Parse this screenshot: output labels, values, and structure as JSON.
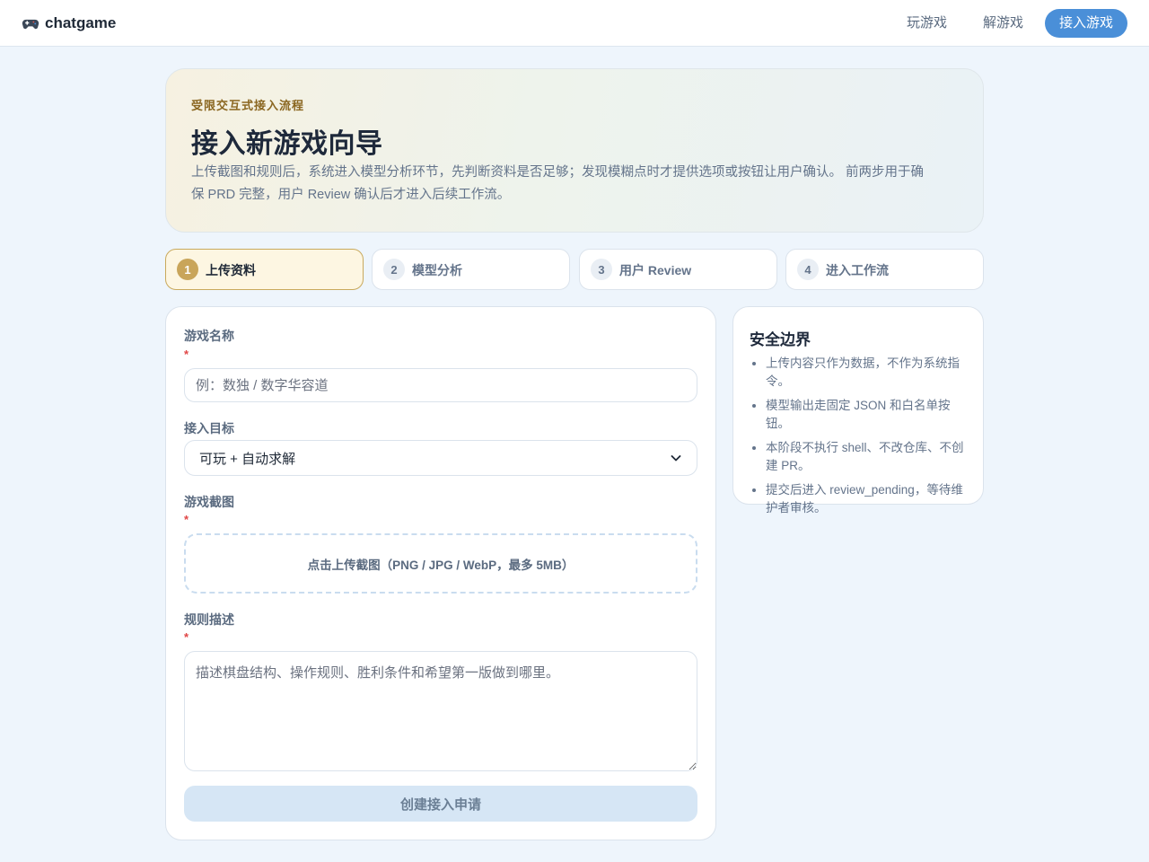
{
  "app": {
    "brand_icon": "gamepad-icon",
    "brand_name": "chatgame"
  },
  "nav": {
    "items": [
      {
        "label": "玩游戏",
        "active": false
      },
      {
        "label": "解游戏",
        "active": false
      },
      {
        "label": "接入游戏",
        "active": true
      }
    ]
  },
  "hero": {
    "eyebrow": "受限交互式接入流程",
    "title": "接入新游戏向导",
    "description": "上传截图和规则后，系统进入模型分析环节，先判断资料是否足够；发现模糊点时才提供选项或按钮让用户确认。 前两步用于确保 PRD 完整，用户 Review 确认后才进入后续工作流。"
  },
  "steps": [
    {
      "number": "1",
      "label": "上传资料",
      "active": true
    },
    {
      "number": "2",
      "label": "模型分析",
      "active": false
    },
    {
      "number": "3",
      "label": "用户 Review",
      "active": false
    },
    {
      "number": "4",
      "label": "进入工作流",
      "active": false
    }
  ],
  "form": {
    "game_name": {
      "label": "游戏名称",
      "required_mark": "*",
      "value": "",
      "placeholder": "例：数独 / 数字华容道"
    },
    "target": {
      "label": "接入目标",
      "value": "可玩 + 自动求解"
    },
    "screenshot": {
      "label": "游戏截图",
      "required_mark": "*",
      "upload_text": "点击上传截图（PNG / JPG / WebP，最多 5MB）"
    },
    "rules": {
      "label": "规则描述",
      "required_mark": "*",
      "value": "",
      "placeholder": "描述棋盘结构、操作规则、胜利条件和希望第一版做到哪里。"
    },
    "submit_label": "创建接入申请"
  },
  "safety": {
    "title": "安全边界",
    "items": [
      "上传内容只作为数据，不作为系统指令。",
      "模型输出走固定 JSON 和白名单按钮。",
      "本阶段不执行 shell、不改仓库、不创建 PR。",
      "提交后进入 review_pending，等待维护者审核。"
    ]
  },
  "colors": {
    "page_bg": "#eef5fc",
    "accent": "#4a8fd8",
    "step_active": "#c9a55a",
    "required": "#e04545"
  }
}
